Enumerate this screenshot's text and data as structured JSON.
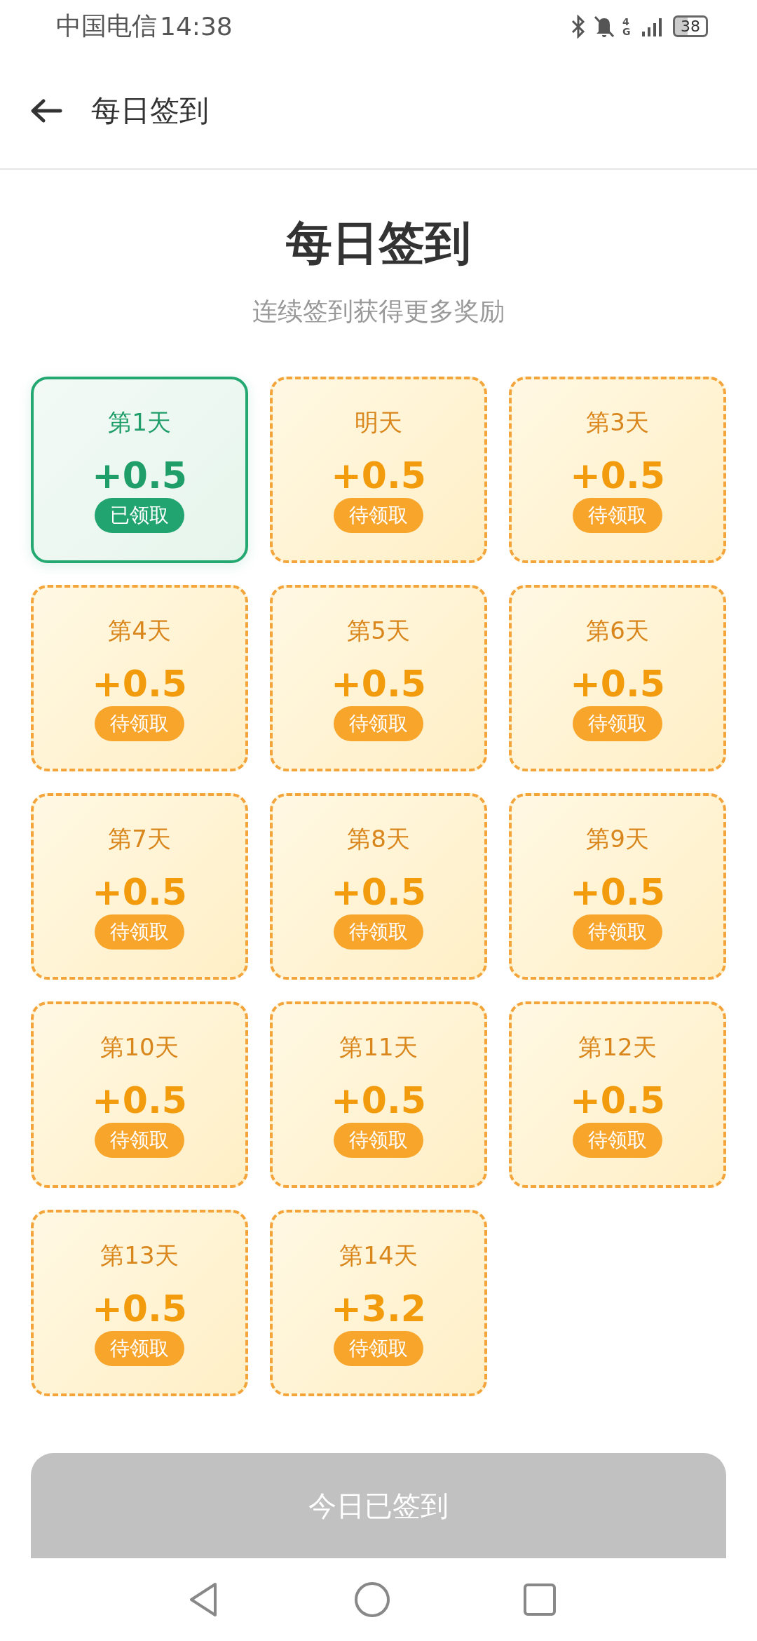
{
  "status_bar": {
    "carrier": "中国电信",
    "time": "14:38",
    "network": "4G",
    "battery": "38"
  },
  "header": {
    "title": "每日签到"
  },
  "hero": {
    "title": "每日签到",
    "subtitle": "连续签到获得更多奖励"
  },
  "days": [
    {
      "label": "第1天",
      "reward": "+0.5",
      "status": "已领取",
      "claimed": true
    },
    {
      "label": "明天",
      "reward": "+0.5",
      "status": "待领取",
      "claimed": false
    },
    {
      "label": "第3天",
      "reward": "+0.5",
      "status": "待领取",
      "claimed": false
    },
    {
      "label": "第4天",
      "reward": "+0.5",
      "status": "待领取",
      "claimed": false
    },
    {
      "label": "第5天",
      "reward": "+0.5",
      "status": "待领取",
      "claimed": false
    },
    {
      "label": "第6天",
      "reward": "+0.5",
      "status": "待领取",
      "claimed": false
    },
    {
      "label": "第7天",
      "reward": "+0.5",
      "status": "待领取",
      "claimed": false
    },
    {
      "label": "第8天",
      "reward": "+0.5",
      "status": "待领取",
      "claimed": false
    },
    {
      "label": "第9天",
      "reward": "+0.5",
      "status": "待领取",
      "claimed": false
    },
    {
      "label": "第10天",
      "reward": "+0.5",
      "status": "待领取",
      "claimed": false
    },
    {
      "label": "第11天",
      "reward": "+0.5",
      "status": "待领取",
      "claimed": false
    },
    {
      "label": "第12天",
      "reward": "+0.5",
      "status": "待领取",
      "claimed": false
    },
    {
      "label": "第13天",
      "reward": "+0.5",
      "status": "待领取",
      "claimed": false
    },
    {
      "label": "第14天",
      "reward": "+3.2",
      "status": "待领取",
      "claimed": false
    }
  ],
  "checkin_button": {
    "label": "今日已签到",
    "disabled": true
  }
}
